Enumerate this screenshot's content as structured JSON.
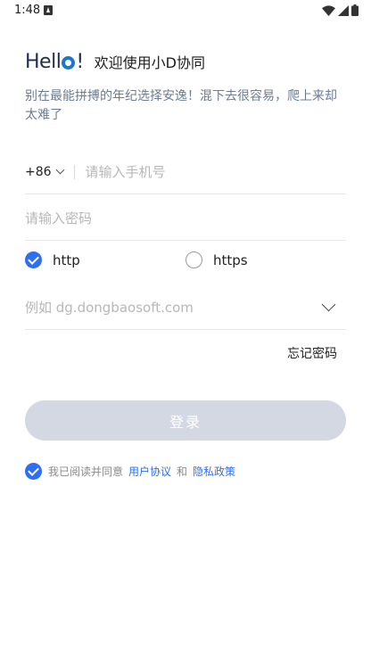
{
  "status_bar": {
    "time": "1:48",
    "icons": [
      "notification-a-icon",
      "wifi-icon",
      "signal-icon",
      "battery-icon"
    ]
  },
  "header": {
    "logo_text_prefix": "Hell",
    "logo_text_suffix": "!",
    "title": "欢迎使用小D协同",
    "subtitle": "别在最能拼搏的年纪选择安逸！混下去很容易，爬上来却太难了"
  },
  "form": {
    "country_code": "+86",
    "phone_placeholder": "请输入手机号",
    "password_placeholder": "请输入密码",
    "protocol_options": [
      {
        "label": "http",
        "selected": true
      },
      {
        "label": "https",
        "selected": false
      }
    ],
    "server_placeholder": "例如 dg.dongbaosoft.com",
    "forgot_password": "忘记密码",
    "login_button": "登录"
  },
  "agreement": {
    "checked": true,
    "prefix": "我已阅读并同意",
    "user_agreement": "用户协议",
    "and": "和",
    "privacy_policy": "隐私政策"
  },
  "colors": {
    "accent": "#2d6ef5",
    "button_disabled": "#d4d8e2",
    "subtitle": "#6b7c94",
    "placeholder": "#b7b7b7"
  }
}
